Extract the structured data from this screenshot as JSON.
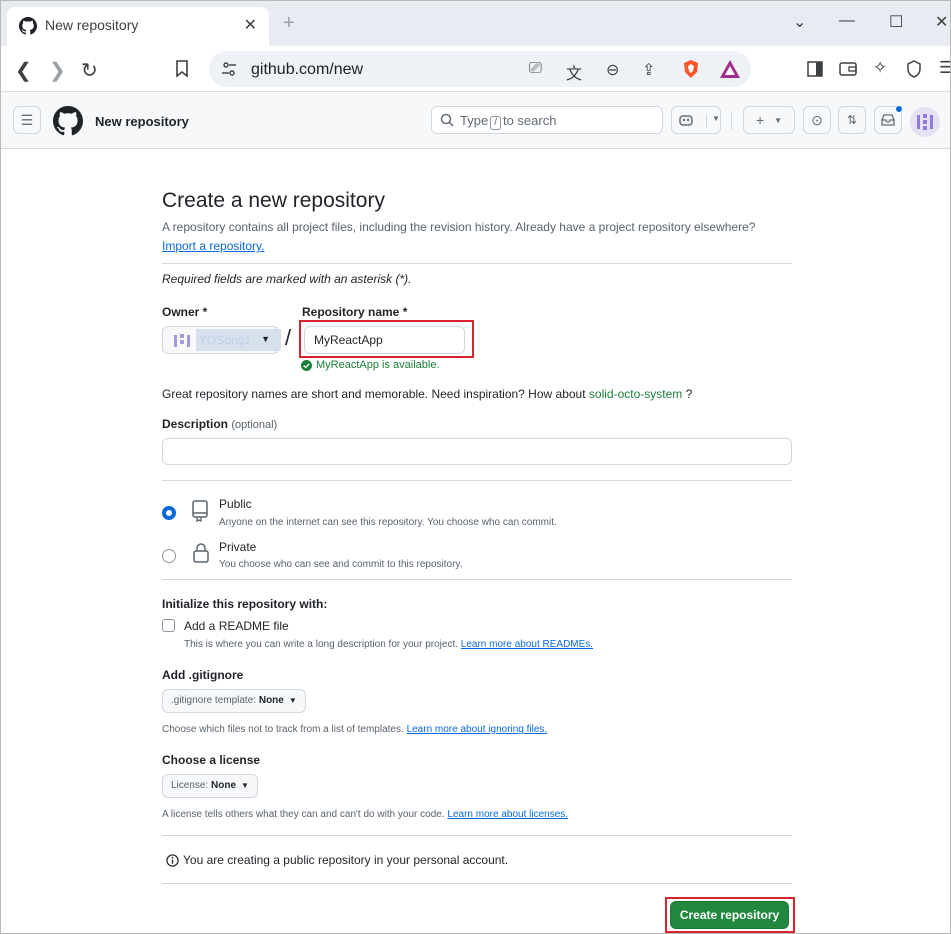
{
  "browser": {
    "tab_title": "New repository",
    "tab_close": "✕",
    "new_tab": "+",
    "url": "github.com/new"
  },
  "header": {
    "page_name": "New repository",
    "search_prefix": "Type",
    "search_key": "/",
    "search_suffix": "to search"
  },
  "form": {
    "title": "Create a new repository",
    "subtitle": "A repository contains all project files, including the revision history. Already have a project repository elsewhere?",
    "import_link": "Import a repository.",
    "required_note": "Required fields are marked with an asterisk (*).",
    "owner_label": "Owner *",
    "owner_value": "YOSong1",
    "slash": "/",
    "repo_label": "Repository name *",
    "repo_value": "MyReactApp",
    "available_msg": "MyReactApp is available.",
    "great_text": "Great repository names are short and memorable. Need inspiration? How about",
    "suggestion": "solid-octo-system",
    "great_suffix": "?",
    "description_label": "Description",
    "description_optional": "(optional)",
    "description_value": "",
    "public_title": "Public",
    "public_desc": "Anyone on the internet can see this repository. You choose who can commit.",
    "private_title": "Private",
    "private_desc": "You choose who can see and commit to this repository.",
    "init_label": "Initialize this repository with:",
    "readme_label": "Add a README file",
    "readme_desc": "This is where you can write a long description for your project.",
    "readme_link": "Learn more about READMEs.",
    "gitignore_label": "Add .gitignore",
    "gitignore_prefix": ".gitignore template:",
    "gitignore_value": "None",
    "gitignore_desc": "Choose which files not to track from a list of templates.",
    "gitignore_link": "Learn more about ignoring files.",
    "license_label": "Choose a license",
    "license_prefix": "License:",
    "license_value": "None",
    "license_desc": "A license tells others what they can and can't do with your code.",
    "license_link": "Learn more about licenses.",
    "info_text": "You are creating a public repository in your personal account.",
    "create_button": "Create repository"
  },
  "colors": {
    "primary_button": "#1f883d",
    "highlight_box": "#d9232e",
    "link": "#0969da"
  }
}
